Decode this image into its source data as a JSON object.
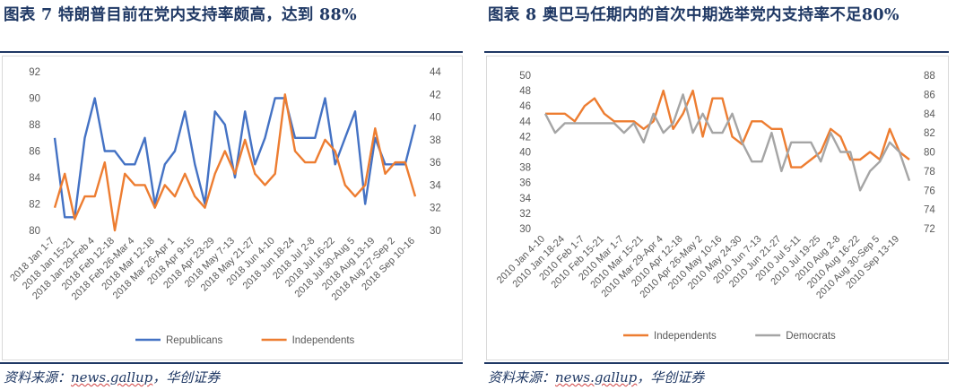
{
  "left": {
    "title": "图表 7   特朗普目前在党内支持率颇高，达到 88%",
    "source": "资料来源：",
    "source_brand": "news.gallup",
    "source_tail": "，华创证券"
  },
  "right": {
    "title": "图表 8   奥巴马任期内的首次中期选举党内支持率不足80%",
    "source": "资料来源：",
    "source_brand": "news.gallup",
    "source_tail": "，华创证券"
  },
  "chart_data": [
    {
      "type": "line",
      "title": "",
      "categories": [
        "2018 Jan 1-7",
        "2018 Jan 8-14",
        "2018 Jan 15-21",
        "2018 Jan 22-28",
        "2018 Jan 29-Feb 4",
        "2018 Feb 5-11",
        "2018 Feb 12-18",
        "2018 Feb 19-25",
        "2018 Feb 26-Mar 4",
        "2018 Mar 5-11",
        "2018 Mar 12-18",
        "2018 Mar 19-25",
        "2018 Mar 26-Apr 1",
        "2018 Apr 2-8",
        "2018 Apr 9-15",
        "2018 Apr 16-22",
        "2018 Apr 23-29",
        "2018 Apr 30-May 6",
        "2018 May 7-13",
        "2018 May 14-20",
        "2018 May 21-27",
        "2018 May 28-Jun 3",
        "2018 Jun 4-10",
        "2018 Jun 11-17",
        "2018 Jun 18-24",
        "2018 Jun 25-Jul 1",
        "2018 Jul 2-8",
        "2018 Jul 9-15",
        "2018 Jul 16-22",
        "2018 Jul 23-29",
        "2018 Jul 30-Aug 5",
        "2018 Aug 6-12",
        "2018 Aug 13-19",
        "2018 Aug 20-26",
        "2018 Aug 27-Sep 2",
        "2018 Sep 3-9",
        "2018 Sep 10-16"
      ],
      "tick_labels": [
        "2018 Jan 1-7",
        "2018 Jan 15-21",
        "2018 Jan 29-Feb 4",
        "2018 Feb 12-18",
        "2018 Feb 26-Mar 4",
        "2018 Mar 12-18",
        "2018 Mar 26-Apr 1",
        "2018 Apr 9-15",
        "2018 Apr 23-29",
        "2018 May 7-13",
        "2018 May 21-27",
        "2018 Jun 4-10",
        "2018 Jun 18-24",
        "2018 Jul 2-8",
        "2018 Jul 16-22",
        "2018 Jul 30-Aug 5",
        "2018 Aug 13-19",
        "2018 Aug 27-Sep 2",
        "2018 Sep 10-16"
      ],
      "y_left": {
        "min": 80,
        "max": 92,
        "step": 2
      },
      "y_right": {
        "min": 30,
        "max": 44,
        "step": 2
      },
      "legend_position": "bottom",
      "series": [
        {
          "name": "Republicans",
          "axis": "left",
          "color": "#4472c4",
          "values": [
            87,
            81,
            81,
            87,
            90,
            86,
            86,
            85,
            85,
            87,
            82,
            85,
            86,
            89,
            85,
            82,
            89,
            88,
            84,
            89,
            85,
            87,
            90,
            90,
            87,
            87,
            87,
            90,
            85,
            87,
            89,
            82,
            87,
            85,
            85,
            85,
            88
          ]
        },
        {
          "name": "Independents",
          "axis": "right",
          "color": "#ed7d31",
          "values": [
            32,
            35,
            31,
            33,
            33,
            36,
            30,
            35,
            34,
            34,
            32,
            34,
            33,
            35,
            33,
            32,
            35,
            37,
            35,
            38,
            35,
            34,
            35,
            42,
            37,
            36,
            36,
            38,
            37,
            34,
            33,
            34,
            39,
            35,
            36,
            36,
            33
          ]
        }
      ],
      "grid": false
    },
    {
      "type": "line",
      "title": "",
      "categories": [
        "2010 Jan 4-10",
        "2010 Jan 11-17",
        "2010 Jan 18-24",
        "2010 Jan 25-31",
        "2010 Feb 1-7",
        "2010 Feb 8-14",
        "2010 Feb 15-21",
        "2010 Feb 22-28",
        "2010 Mar 1-7",
        "2010 Mar 8-14",
        "2010 Mar 15-21",
        "2010 Mar 22-28",
        "2010 Mar 29-Apr 4",
        "2010 Apr 5-11",
        "2010 Apr 12-18",
        "2010 Apr 19-25",
        "2010 Apr 26-May 2",
        "2010 May 3-9",
        "2010 May 10-16",
        "2010 May 17-23",
        "2010 May 24-30",
        "2010 May 31-Jun 6",
        "2010 Jun 7-13",
        "2010 Jun 14-20",
        "2010 Jun 21-27",
        "2010 Jun 28-Jul 4",
        "2010 Jul 5-11",
        "2010 Jul 12-18",
        "2010 Jul 19-25",
        "2010 Jul 26-Aug 1",
        "2010 Aug 2-8",
        "2010 Aug 9-15",
        "2010 Aug 16-22",
        "2010 Aug 23-29",
        "2010 Aug 30-Sep 5",
        "2010 Sep 6-12",
        "2010 Sep 13-19",
        "2010 Sep 20-26"
      ],
      "tick_labels": [
        "2010 Jan 4-10",
        "2010 Jan 18-24",
        "2010 Feb 1-7",
        "2010 Feb 15-21",
        "2010 Mar 1-7",
        "2010 Mar 15-21",
        "2010 Mar 29-Apr 4",
        "2010 Apr 12-18",
        "2010 Apr 26-May 2",
        "2010 May 10-16",
        "2010 May 24-30",
        "2010 Jun 7-13",
        "2010 Jun 21-27",
        "2010 Jul 5-11",
        "2010 Jul 19-25",
        "2010 Aug 2-8",
        "2010 Aug 16-22",
        "2010 Aug 30-Sep 5",
        "2010 Sep 13-19"
      ],
      "y_left": {
        "min": 30,
        "max": 50,
        "step": 2
      },
      "y_right": {
        "min": 72,
        "max": 88,
        "step": 2
      },
      "legend_position": "bottom",
      "series": [
        {
          "name": "Independents",
          "axis": "left",
          "color": "#ed7d31",
          "values": [
            45,
            45,
            45,
            44,
            46,
            47,
            45,
            44,
            44,
            44,
            43,
            44,
            48,
            43,
            45,
            48,
            42,
            47,
            47,
            42,
            41,
            44,
            44,
            43,
            43,
            38,
            38,
            39,
            40,
            43,
            42,
            39,
            39,
            40,
            39,
            43,
            40,
            39
          ]
        },
        {
          "name": "Democrats",
          "axis": "right",
          "color": "#a5a5a5",
          "values": [
            84,
            82,
            83,
            83,
            83,
            83,
            83,
            83,
            82,
            83,
            81,
            84,
            82,
            83,
            86,
            82,
            84,
            82,
            82,
            84,
            81,
            79,
            79,
            82,
            78,
            81,
            81,
            81,
            79,
            82,
            80,
            80,
            76,
            78,
            79,
            81,
            80,
            77
          ]
        }
      ],
      "grid": false
    }
  ]
}
